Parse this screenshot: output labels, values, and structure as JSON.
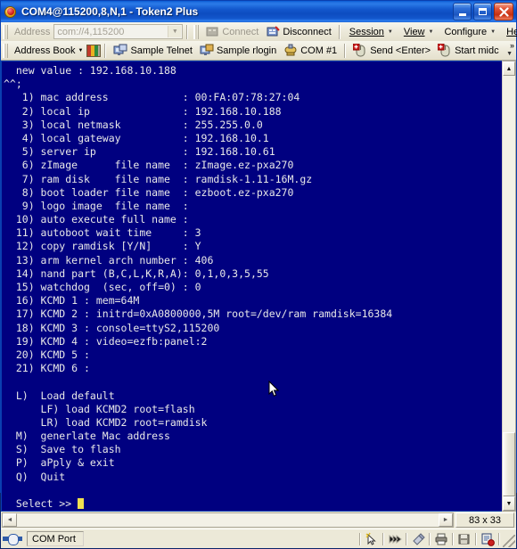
{
  "window": {
    "title": "COM4@115200,8,N,1 - Token2 Plus",
    "app_icon": "token2-app-icon",
    "buttons": {
      "minimize": "minimize",
      "maximize": "maximize",
      "close": "close"
    }
  },
  "toolbar_top": {
    "address_label": "Address",
    "address_value": "com://4,115200",
    "address_placeholder": "com://4,115200",
    "connect_label": "Connect",
    "disconnect_label": "Disconnect",
    "menus": [
      {
        "label": "Session"
      },
      {
        "label": "View"
      },
      {
        "label": "Configure"
      },
      {
        "label": "Help"
      }
    ]
  },
  "toolbar_bottom": {
    "address_book_label": "Address Book",
    "items": [
      {
        "label": "Sample Telnet",
        "icon": "monitor-icon"
      },
      {
        "label": "Sample rlogin",
        "icon": "monitor-icon"
      },
      {
        "label": "COM #1",
        "icon": "serial-port-icon"
      },
      {
        "label": "Send <Enter>",
        "icon": "mouse-macro-icon"
      },
      {
        "label": "Start midc",
        "icon": "mouse-macro-icon"
      }
    ],
    "overflow_label": "»"
  },
  "terminal": {
    "lines": [
      "  new value : 192.168.10.188",
      "^^;",
      "   1) mac address            : 00:FA:07:78:27:04",
      "   2) local ip               : 192.168.10.188",
      "   3) local netmask          : 255.255.0.0",
      "   4) local gateway          : 192.168.10.1",
      "   5) server ip              : 192.168.10.61",
      "   6) zImage      file name  : zImage.ez-pxa270",
      "   7) ram disk    file name  : ramdisk-1.11-16M.gz",
      "   8) boot loader file name  : ezboot.ez-pxa270",
      "   9) logo image  file name  :",
      "  10) auto execute full name :",
      "  11) autoboot wait time     : 3",
      "  12) copy ramdisk [Y/N]     : Y",
      "  13) arm kernel arch number : 406",
      "  14) nand part (B,C,L,K,R,A): 0,1,0,3,5,55",
      "  15) watchdog  (sec, off=0) : 0",
      "  16) KCMD 1 : mem=64M",
      "  17) KCMD 2 : initrd=0xA0800000,5M root=/dev/ram ramdisk=16384",
      "  18) KCMD 3 : console=ttyS2,115200",
      "  19) KCMD 4 : video=ezfb:panel:2",
      "  20) KCMD 5 :",
      "  21) KCMD 6 :",
      "",
      "  L)  Load default",
      "      LF) load KCMD2 root=flash",
      "      LR) load KCMD2 root=ramdisk",
      "  M)  generlate Mac address",
      "  S)  Save to flash",
      "  P)  aPply & exit",
      "  Q)  Quit",
      "",
      "  Select >> "
    ],
    "prompt_cursor": "block-cursor",
    "bg_color": "#000080",
    "fg_color": "#e8e8e8",
    "cursor_color": "#f0e050"
  },
  "scrollbars": {
    "up_arrow": "▲",
    "down_arrow": "▼",
    "left_arrow": "◄",
    "right_arrow": "►",
    "size_indicator": "83 x 33"
  },
  "statusbar": {
    "connection_label": "COM Port",
    "connection_icon": "serial-connector-icon",
    "icons": [
      {
        "name": "auto-select-icon"
      },
      {
        "name": "fast-forward-icon"
      },
      {
        "name": "capture-icon"
      },
      {
        "name": "print-icon"
      },
      {
        "name": "save-icon"
      },
      {
        "name": "log-icon"
      }
    ],
    "resize_grip": "resize-grip"
  },
  "colors": {
    "titlebar_blue": "#0a4fc4",
    "chrome": "#ece9d8",
    "terminal_bg": "#000080",
    "close_red": "#c62f10"
  }
}
